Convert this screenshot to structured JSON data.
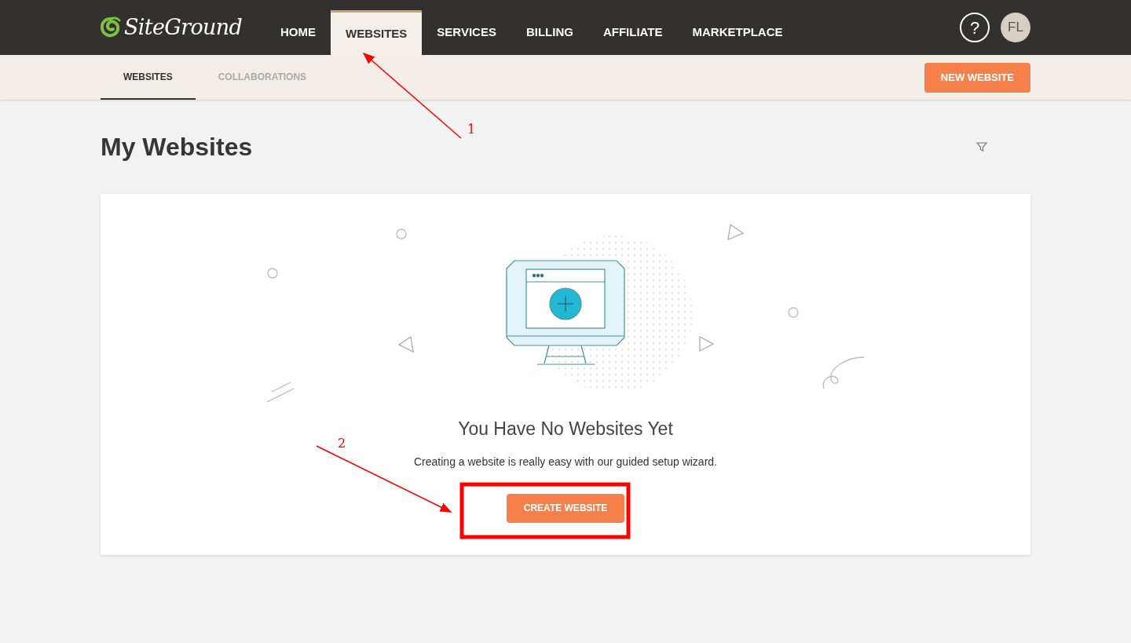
{
  "logo": {
    "text": "SiteGround"
  },
  "nav": [
    {
      "label": "HOME",
      "selected": false
    },
    {
      "label": "WEBSITES",
      "selected": true
    },
    {
      "label": "SERVICES",
      "selected": false
    },
    {
      "label": "BILLING",
      "selected": false
    },
    {
      "label": "AFFILIATE",
      "selected": false
    },
    {
      "label": "MARKETPLACE",
      "selected": false
    }
  ],
  "help": {
    "label": "?"
  },
  "avatar": {
    "initials": "FL"
  },
  "subtabs": [
    {
      "label": "WEBSITES",
      "selected": true
    },
    {
      "label": "COLLABORATIONS",
      "selected": false
    }
  ],
  "new_website_button": "NEW WEBSITE",
  "page_title": "My Websites",
  "empty_state": {
    "title": "You Have No Websites Yet",
    "text": "Creating a website is really easy with our guided setup wizard.",
    "button": "CREATE WEBSITE"
  },
  "annotations": [
    {
      "label": "1"
    },
    {
      "label": "2"
    }
  ]
}
